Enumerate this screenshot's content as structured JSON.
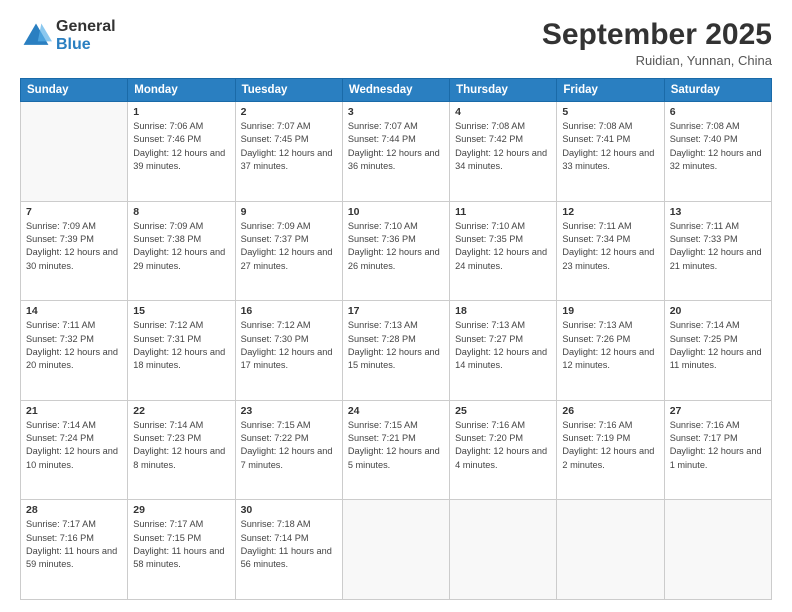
{
  "header": {
    "logo_general": "General",
    "logo_blue": "Blue",
    "month_title": "September 2025",
    "location": "Ruidian, Yunnan, China"
  },
  "days_of_week": [
    "Sunday",
    "Monday",
    "Tuesday",
    "Wednesday",
    "Thursday",
    "Friday",
    "Saturday"
  ],
  "weeks": [
    [
      {
        "day": "",
        "empty": true
      },
      {
        "day": "1",
        "sunrise": "7:06 AM",
        "sunset": "7:46 PM",
        "daylight": "12 hours and 39 minutes."
      },
      {
        "day": "2",
        "sunrise": "7:07 AM",
        "sunset": "7:45 PM",
        "daylight": "12 hours and 37 minutes."
      },
      {
        "day": "3",
        "sunrise": "7:07 AM",
        "sunset": "7:44 PM",
        "daylight": "12 hours and 36 minutes."
      },
      {
        "day": "4",
        "sunrise": "7:08 AM",
        "sunset": "7:42 PM",
        "daylight": "12 hours and 34 minutes."
      },
      {
        "day": "5",
        "sunrise": "7:08 AM",
        "sunset": "7:41 PM",
        "daylight": "12 hours and 33 minutes."
      },
      {
        "day": "6",
        "sunrise": "7:08 AM",
        "sunset": "7:40 PM",
        "daylight": "12 hours and 32 minutes."
      }
    ],
    [
      {
        "day": "7",
        "sunrise": "7:09 AM",
        "sunset": "7:39 PM",
        "daylight": "12 hours and 30 minutes."
      },
      {
        "day": "8",
        "sunrise": "7:09 AM",
        "sunset": "7:38 PM",
        "daylight": "12 hours and 29 minutes."
      },
      {
        "day": "9",
        "sunrise": "7:09 AM",
        "sunset": "7:37 PM",
        "daylight": "12 hours and 27 minutes."
      },
      {
        "day": "10",
        "sunrise": "7:10 AM",
        "sunset": "7:36 PM",
        "daylight": "12 hours and 26 minutes."
      },
      {
        "day": "11",
        "sunrise": "7:10 AM",
        "sunset": "7:35 PM",
        "daylight": "12 hours and 24 minutes."
      },
      {
        "day": "12",
        "sunrise": "7:11 AM",
        "sunset": "7:34 PM",
        "daylight": "12 hours and 23 minutes."
      },
      {
        "day": "13",
        "sunrise": "7:11 AM",
        "sunset": "7:33 PM",
        "daylight": "12 hours and 21 minutes."
      }
    ],
    [
      {
        "day": "14",
        "sunrise": "7:11 AM",
        "sunset": "7:32 PM",
        "daylight": "12 hours and 20 minutes."
      },
      {
        "day": "15",
        "sunrise": "7:12 AM",
        "sunset": "7:31 PM",
        "daylight": "12 hours and 18 minutes."
      },
      {
        "day": "16",
        "sunrise": "7:12 AM",
        "sunset": "7:30 PM",
        "daylight": "12 hours and 17 minutes."
      },
      {
        "day": "17",
        "sunrise": "7:13 AM",
        "sunset": "7:28 PM",
        "daylight": "12 hours and 15 minutes."
      },
      {
        "day": "18",
        "sunrise": "7:13 AM",
        "sunset": "7:27 PM",
        "daylight": "12 hours and 14 minutes."
      },
      {
        "day": "19",
        "sunrise": "7:13 AM",
        "sunset": "7:26 PM",
        "daylight": "12 hours and 12 minutes."
      },
      {
        "day": "20",
        "sunrise": "7:14 AM",
        "sunset": "7:25 PM",
        "daylight": "12 hours and 11 minutes."
      }
    ],
    [
      {
        "day": "21",
        "sunrise": "7:14 AM",
        "sunset": "7:24 PM",
        "daylight": "12 hours and 10 minutes."
      },
      {
        "day": "22",
        "sunrise": "7:14 AM",
        "sunset": "7:23 PM",
        "daylight": "12 hours and 8 minutes."
      },
      {
        "day": "23",
        "sunrise": "7:15 AM",
        "sunset": "7:22 PM",
        "daylight": "12 hours and 7 minutes."
      },
      {
        "day": "24",
        "sunrise": "7:15 AM",
        "sunset": "7:21 PM",
        "daylight": "12 hours and 5 minutes."
      },
      {
        "day": "25",
        "sunrise": "7:16 AM",
        "sunset": "7:20 PM",
        "daylight": "12 hours and 4 minutes."
      },
      {
        "day": "26",
        "sunrise": "7:16 AM",
        "sunset": "7:19 PM",
        "daylight": "12 hours and 2 minutes."
      },
      {
        "day": "27",
        "sunrise": "7:16 AM",
        "sunset": "7:17 PM",
        "daylight": "12 hours and 1 minute."
      }
    ],
    [
      {
        "day": "28",
        "sunrise": "7:17 AM",
        "sunset": "7:16 PM",
        "daylight": "11 hours and 59 minutes."
      },
      {
        "day": "29",
        "sunrise": "7:17 AM",
        "sunset": "7:15 PM",
        "daylight": "11 hours and 58 minutes."
      },
      {
        "day": "30",
        "sunrise": "7:18 AM",
        "sunset": "7:14 PM",
        "daylight": "11 hours and 56 minutes."
      },
      {
        "day": "",
        "empty": true
      },
      {
        "day": "",
        "empty": true
      },
      {
        "day": "",
        "empty": true
      },
      {
        "day": "",
        "empty": true
      }
    ]
  ]
}
